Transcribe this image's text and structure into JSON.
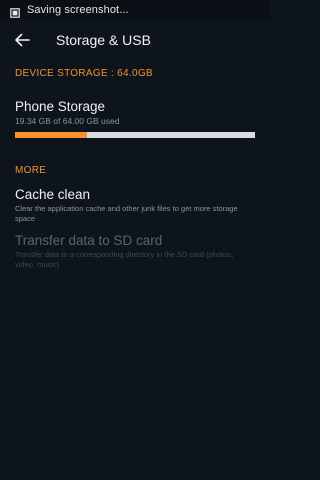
{
  "status_bar": {
    "text": "Saving screenshot..."
  },
  "app_bar": {
    "title": "Storage & USB",
    "back_icon": "arrow-left-icon"
  },
  "device_storage": {
    "header": "DEVICE STORAGE : 64.0GB",
    "phone_storage": {
      "title": "Phone Storage",
      "summary": "19.34 GB of 64.00 GB used",
      "used_fraction": 0.302
    }
  },
  "more": {
    "header": "MORE",
    "cache_clean": {
      "title": "Cache clean",
      "description": "Clear the application cache and other junk files to get more storage space"
    },
    "transfer": {
      "title": "Transfer data to SD card",
      "description": "Transfer data to a corresponding directory in the SD card (photos, video, music)",
      "enabled": false
    }
  },
  "colors": {
    "background": "#0e141c",
    "accent": "#f5922b",
    "progress_track": "#d9dde2"
  }
}
